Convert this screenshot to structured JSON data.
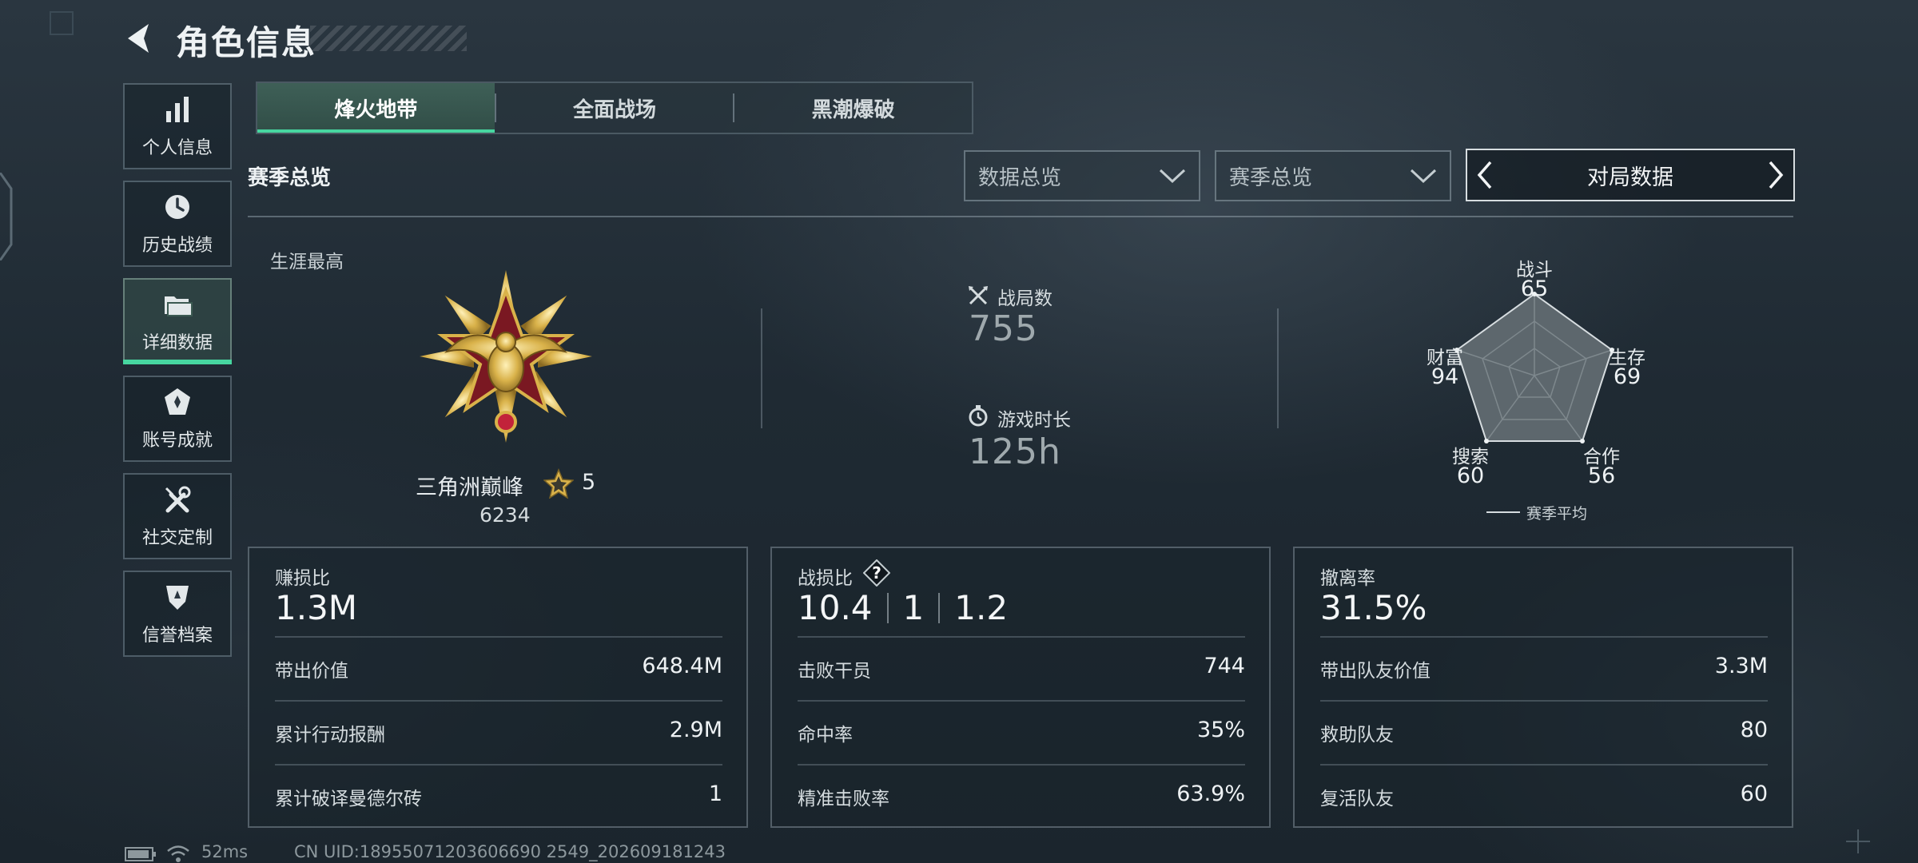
{
  "header": {
    "title": "角色信息"
  },
  "nav": {
    "items": [
      {
        "label": "个人信息",
        "icon": "bar-chart-icon",
        "active": false
      },
      {
        "label": "历史战绩",
        "icon": "clock-icon",
        "active": false
      },
      {
        "label": "详细数据",
        "icon": "folder-icon",
        "active": true
      },
      {
        "label": "账号成就",
        "icon": "achievement-icon",
        "active": false
      },
      {
        "label": "社交定制",
        "icon": "tools-icon",
        "active": false
      },
      {
        "label": "信誉档案",
        "icon": "shield-icon",
        "active": false
      }
    ]
  },
  "tabs": [
    {
      "label": "烽火地带",
      "active": true
    },
    {
      "label": "全面战场",
      "active": false
    },
    {
      "label": "黑潮爆破",
      "active": false
    }
  ],
  "section": {
    "title": "赛季总览"
  },
  "filters": {
    "data_select": "数据总览",
    "season_select": "赛季总览",
    "view_switch": "对局数据"
  },
  "rank": {
    "label": "生涯最高",
    "name": "三角洲巅峰",
    "stars": "5",
    "score": "6234"
  },
  "overview": {
    "matches_label": "战局数",
    "matches_value": "755",
    "playtime_label": "游戏时长",
    "playtime_value": "125h"
  },
  "radar": {
    "axes": [
      {
        "label": "战斗",
        "value": "65"
      },
      {
        "label": "生存",
        "value": "69"
      },
      {
        "label": "合作",
        "value": "56"
      },
      {
        "label": "搜索",
        "value": "60"
      },
      {
        "label": "财富",
        "value": "94"
      }
    ],
    "legend": "赛季平均"
  },
  "cards": {
    "profit": {
      "label": "赚损比",
      "value": "1.3M",
      "rows": [
        {
          "label": "带出价值",
          "value": "648.4M"
        },
        {
          "label": "累计行动报酬",
          "value": "2.9M"
        },
        {
          "label": "累计破译曼德尔砖",
          "value": "1"
        }
      ]
    },
    "kd": {
      "label": "战损比",
      "help": "?",
      "values": [
        "10.4",
        "1",
        "1.2"
      ],
      "rows": [
        {
          "label": "击败干员",
          "value": "744"
        },
        {
          "label": "命中率",
          "value": "35%"
        },
        {
          "label": "精准击败率",
          "value": "63.9%"
        }
      ]
    },
    "extract": {
      "label": "撤离率",
      "value": "31.5%",
      "rows": [
        {
          "label": "带出队友价值",
          "value": "3.3M"
        },
        {
          "label": "救助队友",
          "value": "80"
        },
        {
          "label": "复活队友",
          "value": "60"
        }
      ]
    }
  },
  "footer": {
    "ping": "52ms",
    "uid": "CN UID:18955071203606690 2549_202609181243"
  },
  "colors": {
    "accent": "#47d6a0",
    "gold": "#d9b24a"
  }
}
